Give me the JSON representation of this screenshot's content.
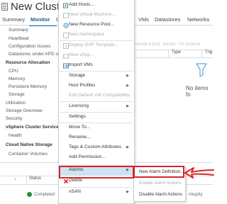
{
  "window": {
    "title": "New Cluster"
  },
  "tabs": [
    {
      "label": "Summary"
    },
    {
      "label": "Monitor",
      "active": true
    },
    {
      "label": "C"
    },
    {
      "label": "VMs"
    },
    {
      "label": "Datastores"
    },
    {
      "label": "Networks"
    }
  ],
  "sidebar": {
    "items": [
      {
        "label": "Summary"
      },
      {
        "label": "Heartbeat"
      },
      {
        "label": "Configuration Issues"
      },
      {
        "label": "Datastores under APD or"
      },
      {
        "label": "Resource Allocation"
      },
      {
        "label": "CPU"
      },
      {
        "label": "Memory"
      },
      {
        "label": "Persistent Memory"
      },
      {
        "label": "Storage"
      },
      {
        "label": "Utilization"
      },
      {
        "label": "Storage Overview"
      },
      {
        "label": "Security"
      },
      {
        "label": "vSphere Cluster Services"
      },
      {
        "label": "Health"
      },
      {
        "label": "Cloud Native Storage"
      },
      {
        "label": "Container Volumes"
      }
    ]
  },
  "content": {
    "toolbar": {
      "acknowledge": "KNOWLEDGE",
      "reset": "RESET TO GREEN"
    },
    "grid_headers": [
      "Type",
      "Trig"
    ],
    "empty_text": "No items fo"
  },
  "bottom_panel": {
    "headers": [
      "Status"
    ],
    "row": [
      "Completed",
      "ntegrity"
    ]
  },
  "context_menu": {
    "items": [
      {
        "label": "Add Hosts...",
        "icon": "add-host-icon"
      },
      {
        "label": "New Virtual Machine...",
        "icon": "new-vm-icon",
        "disabled": true
      },
      {
        "label": "New Resource Pool...",
        "icon": "resource-pool-icon"
      },
      {
        "label": "New Namespace",
        "icon": "namespace-icon",
        "disabled": true
      },
      {
        "label": "Deploy OVF Template...",
        "icon": "deploy-ovf-icon",
        "disabled": true
      },
      {
        "label": "New vApp...",
        "icon": "vapp-icon",
        "disabled": true
      },
      {
        "label": "Import VMs",
        "icon": "import-vms-icon"
      },
      {
        "label": "Storage",
        "submenu": true
      },
      {
        "label": "Host Profiles",
        "submenu": true
      },
      {
        "label": "Edit Default VM Compatibility...",
        "disabled": true
      },
      {
        "label": "Licensing",
        "submenu": true
      },
      {
        "label": "Settings"
      },
      {
        "label": "Move To..."
      },
      {
        "label": "Rename..."
      },
      {
        "label": "Tags & Custom Attributes",
        "submenu": true
      },
      {
        "label": "Add Permission..."
      },
      {
        "label": "Alarms",
        "submenu": true,
        "highlighted": true
      },
      {
        "label": "Delete",
        "icon": "delete-icon"
      },
      {
        "label": "vSAN",
        "submenu": true
      }
    ]
  },
  "alarms_submenu": {
    "items": [
      {
        "label": "New Alarm Definition..."
      },
      {
        "label": "Enable Alarm Actions",
        "disabled": true
      },
      {
        "label": "Disable Alarm Actions"
      }
    ]
  },
  "colors": {
    "accent": "#0b7bc2",
    "annotation": "#d92528",
    "highlight": "#cce4f2",
    "disabled_text": "#a9afb3"
  }
}
